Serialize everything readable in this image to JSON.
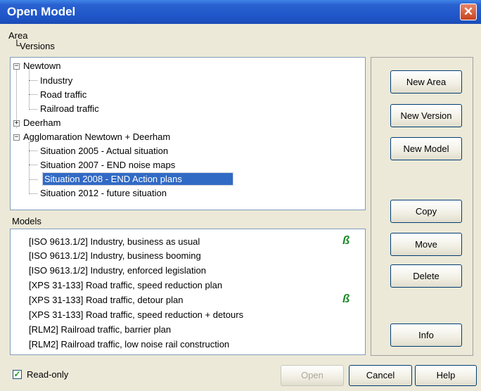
{
  "window": {
    "title": "Open Model",
    "close_symbol": "✕"
  },
  "header": {
    "area": "Area",
    "versions": "Versions"
  },
  "tree": {
    "items": [
      {
        "label": "Newtown",
        "expander": "−"
      },
      {
        "label": "Industry"
      },
      {
        "label": "Road traffic"
      },
      {
        "label": "Railroad traffic"
      },
      {
        "label": "Deerham",
        "expander": "+"
      },
      {
        "label": "Agglomaration Newtown + Deerham",
        "expander": "−"
      },
      {
        "label": "Situation 2005 - Actual situation"
      },
      {
        "label": "Situation 2007 - END noise maps"
      },
      {
        "label": "Situation 2008 - END Action plans",
        "selected": true
      },
      {
        "label": "Situation 2012 - future situation"
      }
    ]
  },
  "models": {
    "title": "Models",
    "items": [
      {
        "label": "[ISO 9613.1/2] Industry, business as usual",
        "marked": true
      },
      {
        "label": "[ISO 9613.1/2] Industry, business booming"
      },
      {
        "label": "[ISO 9613.1/2] Industry, enforced legislation"
      },
      {
        "label": "[XPS 31-133] Road traffic, speed reduction  plan"
      },
      {
        "label": "[XPS 31-133] Road traffic, detour plan",
        "marked": true
      },
      {
        "label": "[XPS 31-133] Road traffic, speed reduction + detours"
      },
      {
        "label": "[RLM2] Railroad traffic, barrier plan"
      },
      {
        "label": "[RLM2] Railroad traffic, low noise rail construction"
      }
    ],
    "mark_glyph": "ß"
  },
  "buttons": {
    "new_area": "New Area",
    "new_version": "New Version",
    "new_model": "New Model",
    "copy": "Copy",
    "move": "Move",
    "delete": "Delete",
    "info": "Info",
    "open": "Open",
    "cancel": "Cancel",
    "help": "Help"
  },
  "readonly": {
    "label": "Read-only",
    "checked": true,
    "check_glyph": "✓"
  },
  "colors": {
    "titlebar": "#1f55c8",
    "selection": "#316ac5",
    "mark": "#1f8a2a"
  }
}
